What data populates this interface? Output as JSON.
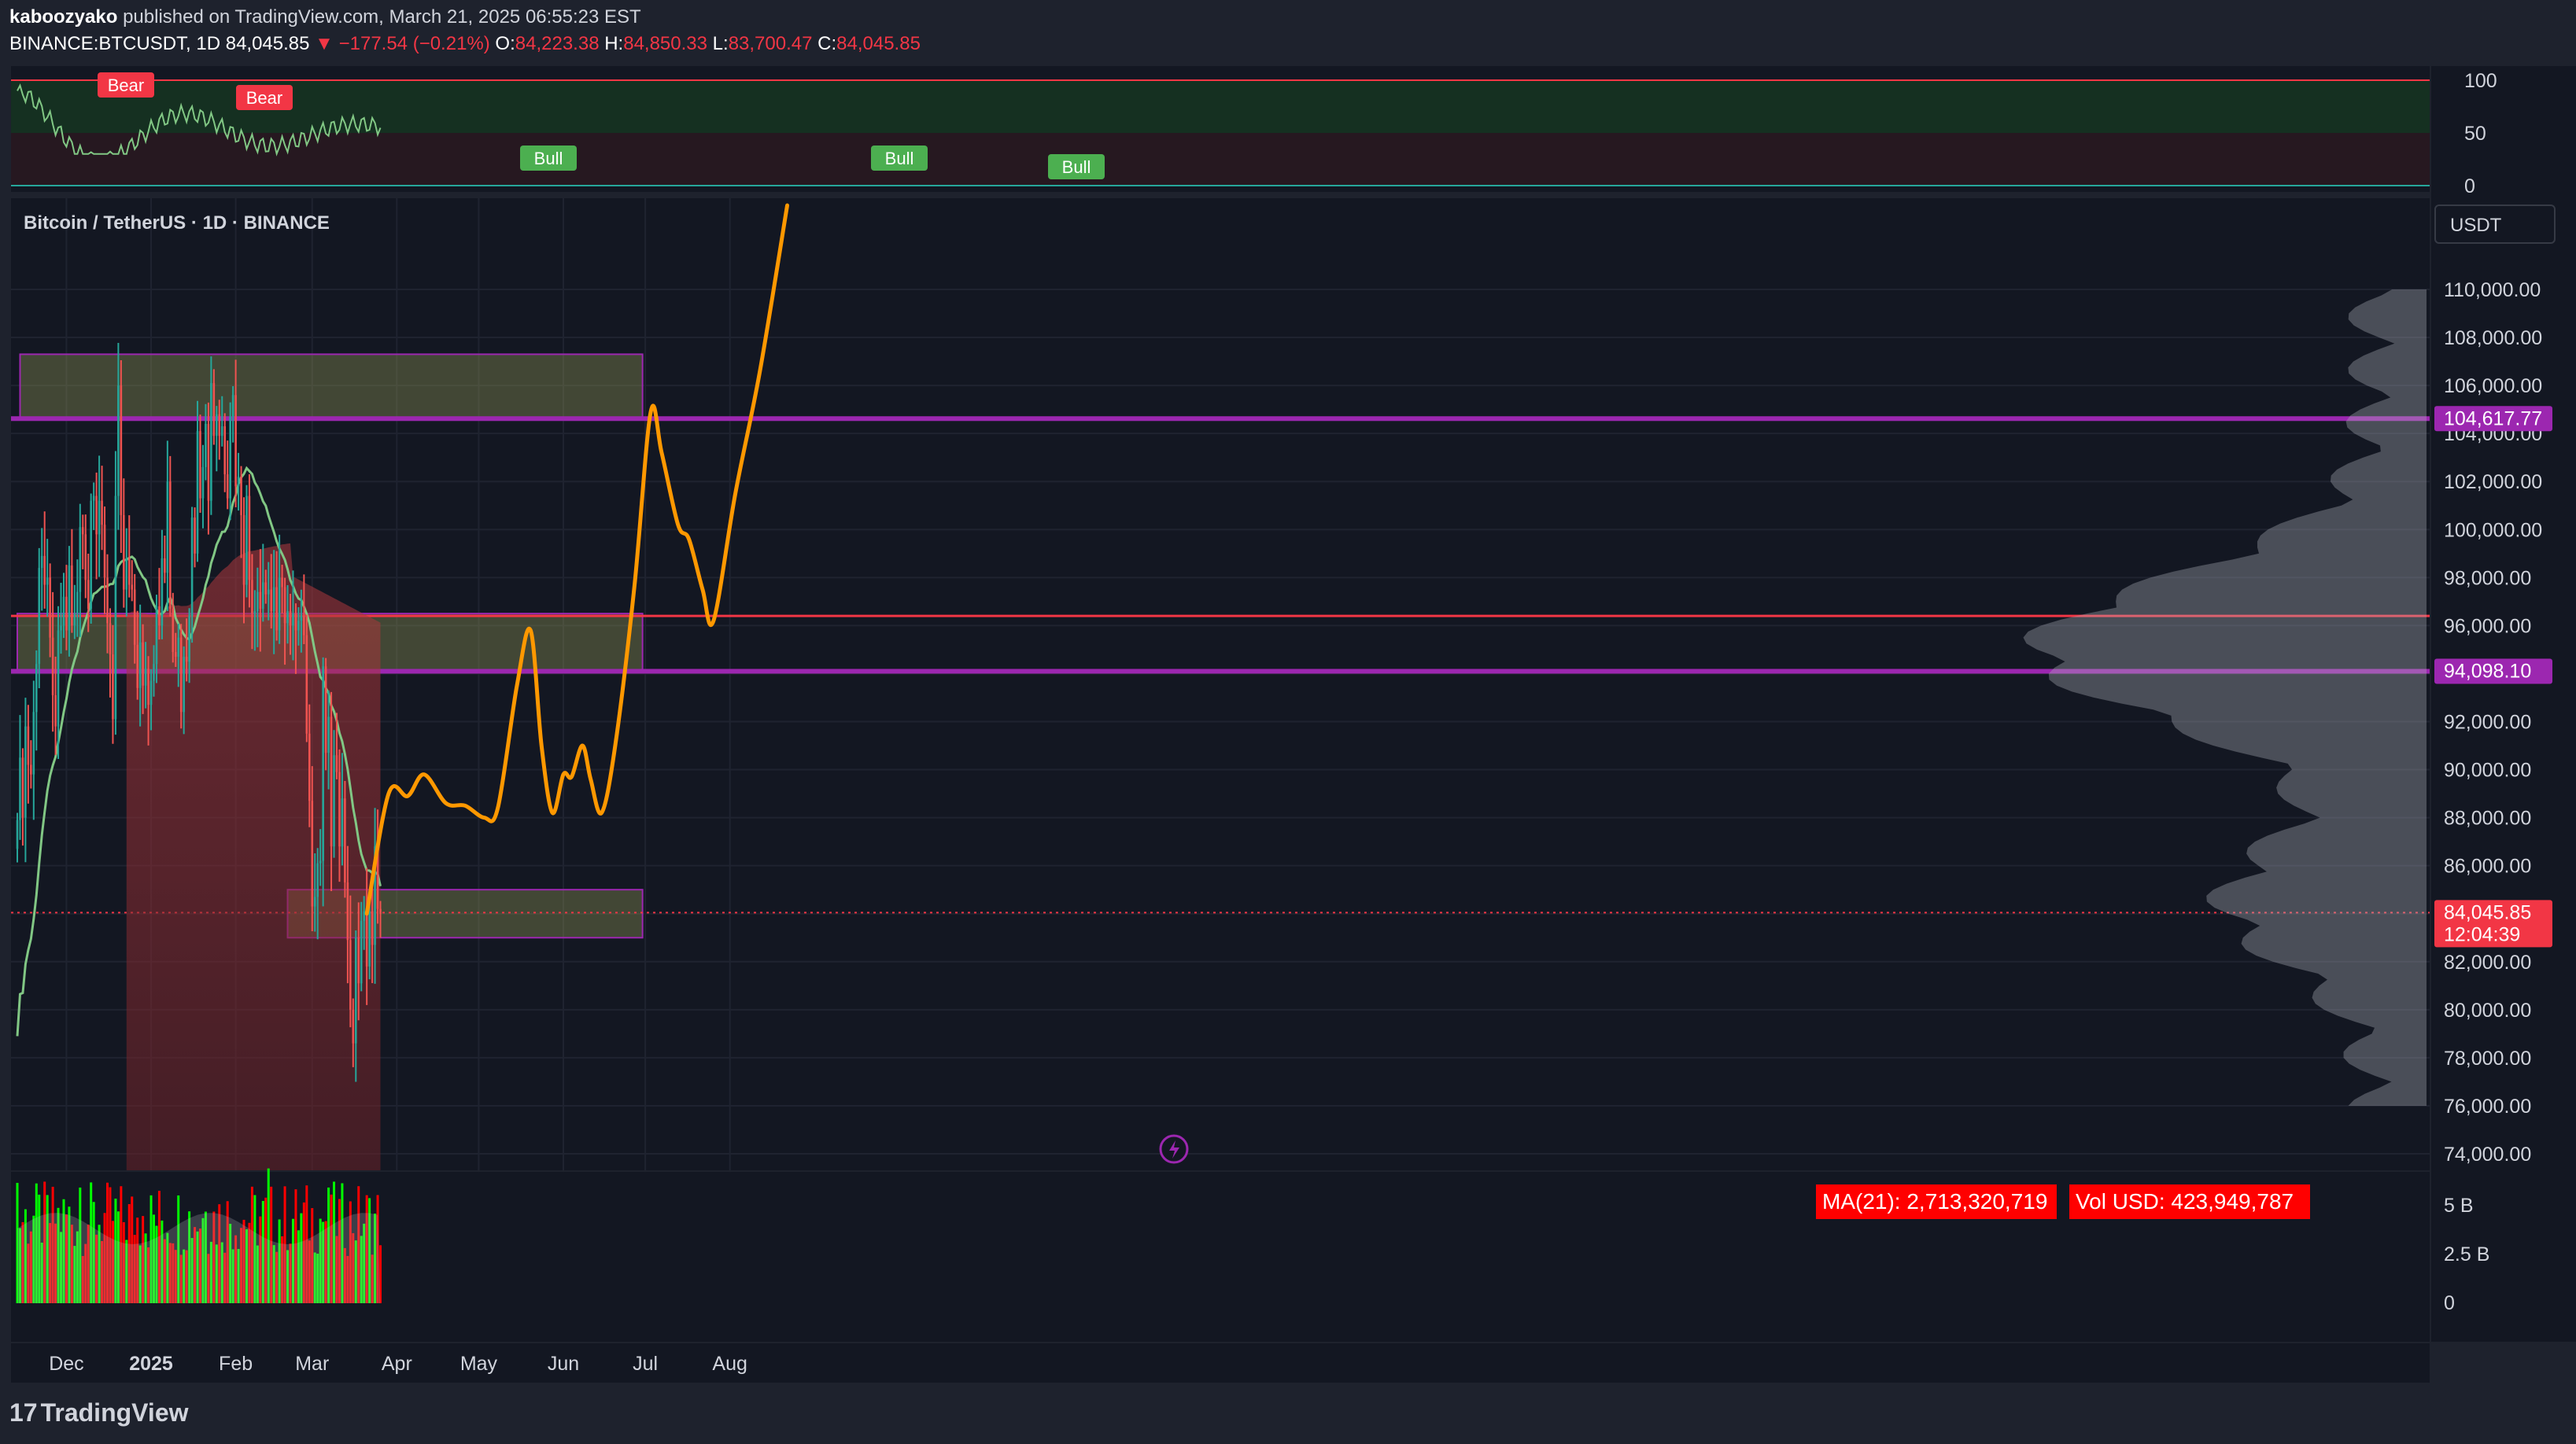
{
  "header": {
    "publisher": "kaboozyako",
    "published_text": "published on TradingView.com, March 21, 2025 06:55:23 EST",
    "symbol": "BINANCE:BTCUSDT, 1D",
    "last": "84,045.85",
    "change": "−177.54 (−0.21%)",
    "open_label": "O:",
    "open": "84,223.38",
    "high_label": "H:",
    "high": "84,850.33",
    "low_label": "L:",
    "low": "83,700.47",
    "close_label": "C:",
    "close": "84,045.85"
  },
  "pane_title": "Bitcoin / TetherUS · 1D · BINANCE",
  "currency_button": "USDT",
  "brand": "TradingView",
  "chart_data": {
    "type": "candlestick",
    "title": "Bitcoin / TetherUS · 1D · BINANCE",
    "ylabel": "USDT",
    "ylim": [
      74000,
      114000
    ],
    "y_ticks": [
      "110,000.00",
      "108,000.00",
      "106,000.00",
      "104,000.00",
      "102,000.00",
      "100,000.00",
      "98,000.00",
      "96,000.00",
      "94,000.00",
      "92,000.00",
      "90,000.00",
      "88,000.00",
      "86,000.00",
      "84,000.00",
      "82,000.00",
      "80,000.00",
      "78,000.00",
      "76,000.00",
      "74,000.00"
    ],
    "x_ticks": [
      "Dec",
      "2025",
      "Feb",
      "Mar",
      "Apr",
      "May",
      "Jun",
      "Jul",
      "Aug"
    ],
    "grid": true,
    "price_labels": [
      {
        "value": 104617.77,
        "text": "104,617.77",
        "color": "#9c27b0"
      },
      {
        "value": 94098.1,
        "text": "94,098.10",
        "color": "#9c27b0"
      },
      {
        "value": 84045.85,
        "text": "84,045.85",
        "sub": "12:04:39",
        "color": "#f23645"
      }
    ],
    "close_series": {
      "start": "2024-11-13",
      "values": [
        87900,
        90500,
        88000,
        91800,
        90200,
        89800,
        92400,
        94400,
        98400,
        98900,
        97700,
        98000,
        95500,
        93100,
        91800,
        95800,
        96000,
        97200,
        95800,
        98500,
        96000,
        96500,
        97400,
        100100,
        99800,
        97900,
        96700,
        101200,
        101400,
        99800,
        101200,
        100200,
        98000,
        96100,
        94800,
        92100,
        101400,
        106000,
        100600,
        97500,
        98800,
        97700,
        97500,
        95200,
        93400,
        95300,
        93500,
        94200,
        92700,
        93700,
        94400,
        96800,
        96000,
        98800,
        98200,
        102000,
        96700,
        94900,
        94700,
        95500,
        92400,
        94700,
        94500,
        96400,
        100500,
        99000,
        104100,
        101300,
        102600,
        104400,
        101200,
        106100,
        103900,
        104800,
        103900,
        104300,
        102300,
        101300,
        104700,
        105600,
        101800,
        102200,
        100600,
        97700,
        101400,
        97900,
        96500,
        96600,
        97400,
        96700,
        97800,
        97300,
        97500,
        96600,
        97600,
        95800,
        98000,
        97600,
        96100,
        96600,
        96000,
        96500,
        95800,
        96200,
        96400,
        95600,
        91500,
        88700,
        84300,
        84700,
        86100,
        86200,
        94300,
        90700,
        92200,
        86800,
        90600,
        89900,
        86800,
        88800,
        85300,
        82900,
        80000,
        78600,
        83000,
        81100,
        83700,
        84100,
        81800,
        84100,
        82700,
        86800,
        84200,
        84000
      ]
    },
    "key_levels": [
      {
        "type": "zone",
        "from": 104617.77,
        "to": 107300,
        "start": "2024-11-14",
        "end": "2025-06-30"
      },
      {
        "type": "line",
        "value": 104617.77
      },
      {
        "type": "zone",
        "from": 94098.1,
        "to": 96500,
        "start": "2024-11-13",
        "end": "2025-06-30"
      },
      {
        "type": "line",
        "value": 94098.1
      },
      {
        "type": "line",
        "value": 96400,
        "color": "#f23645"
      },
      {
        "type": "zone",
        "from": 83000,
        "to": 85000,
        "start": "2025-02-20",
        "end": "2025-06-30"
      }
    ],
    "projection": {
      "name": "",
      "points": [
        [
          "2025-03-21",
          84000
        ],
        [
          "2025-03-29",
          89000
        ],
        [
          "2025-04-05",
          88900
        ],
        [
          "2025-04-11",
          89800
        ],
        [
          "2025-04-19",
          88600
        ],
        [
          "2025-04-26",
          88500
        ],
        [
          "2025-05-03",
          88000
        ],
        [
          "2025-05-08",
          88400
        ],
        [
          "2025-05-15",
          93500
        ],
        [
          "2025-05-20",
          95800
        ],
        [
          "2025-05-24",
          91000
        ],
        [
          "2025-05-28",
          88200
        ],
        [
          "2025-06-01",
          89800
        ],
        [
          "2025-06-04",
          89700
        ],
        [
          "2025-06-08",
          91000
        ],
        [
          "2025-06-11",
          89600
        ],
        [
          "2025-06-15",
          88200
        ],
        [
          "2025-06-20",
          91000
        ],
        [
          "2025-06-27",
          97600
        ],
        [
          "2025-07-03",
          104900
        ],
        [
          "2025-07-07",
          103200
        ],
        [
          "2025-07-13",
          100200
        ],
        [
          "2025-07-17",
          99600
        ],
        [
          "2025-07-22",
          97500
        ],
        [
          "2025-07-26",
          96200
        ],
        [
          "2025-08-03",
          101500
        ],
        [
          "2025-08-12",
          106600
        ],
        [
          "2025-08-22",
          113500
        ]
      ]
    },
    "ma21_color": "#81c784"
  },
  "rsi_pane": {
    "ticks": [
      "100",
      "50",
      "0"
    ],
    "signals": [
      {
        "text": "Bear",
        "kind": "bear"
      },
      {
        "text": "Bear",
        "kind": "bear"
      },
      {
        "text": "Bull",
        "kind": "bull"
      },
      {
        "text": "Bull",
        "kind": "bull"
      },
      {
        "text": "Bull",
        "kind": "bull"
      }
    ]
  },
  "volume_pane": {
    "ticks": [
      "5 B",
      "2.5 B",
      "0"
    ],
    "ma_label": "MA(21): 2,713,320,719",
    "vol_label": "Vol USD: 423,949,787",
    "up_color": "#00ff00",
    "down_color": "#ff0000"
  },
  "colors": {
    "background": "#131722",
    "up": "#26a69a",
    "down": "#ef5350",
    "purple": "#9c27b0",
    "orange": "#ff9800"
  }
}
